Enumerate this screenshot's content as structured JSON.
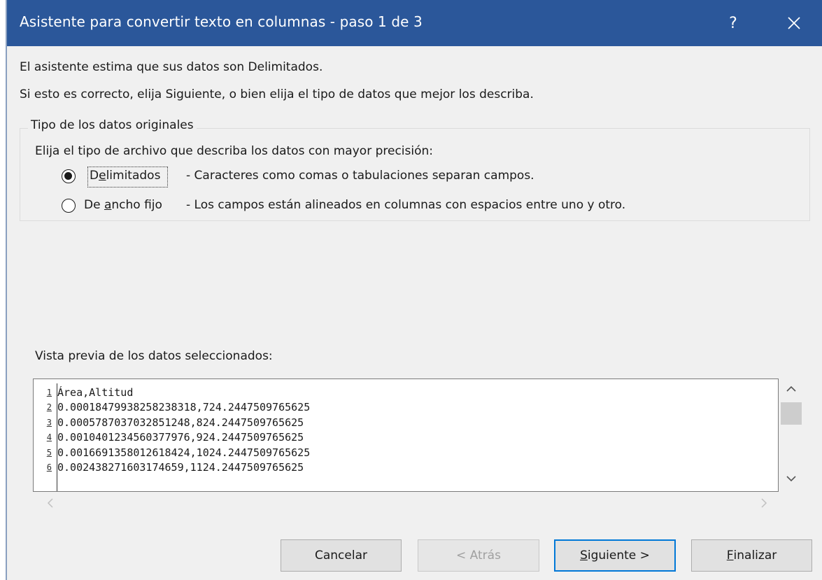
{
  "window": {
    "title": "Asistente para convertir texto en columnas - paso 1 de 3",
    "help_label": "?",
    "close_icon": "close-icon",
    "titlebar_color": "#2b579a"
  },
  "intro": {
    "line1": "El asistente estima que sus datos son Delimitados.",
    "line2": "Si esto es correcto, elija Siguiente, o bien elija el tipo de datos que mejor los describa."
  },
  "group": {
    "legend": "Tipo de los datos originales",
    "prompt": "Elija el tipo de archivo que describa los datos con mayor precisión:",
    "options": [
      {
        "label_pre": "D",
        "label_accel": "e",
        "label_post": "limitados",
        "description": "- Caracteres como comas o tabulaciones separan campos.",
        "selected": true
      },
      {
        "label_pre": "De ",
        "label_accel": "a",
        "label_post": "ncho fijo",
        "description": "- Los campos están alineados en columnas con espacios entre uno y otro.",
        "selected": false
      }
    ]
  },
  "preview": {
    "label": "Vista previa de los datos seleccionados:",
    "rows": [
      {
        "num": "1",
        "text": "Área,Altitud"
      },
      {
        "num": "2",
        "text": "0.00018479938258238318,724.2447509765625"
      },
      {
        "num": "3",
        "text": "0.0005787037032851248,824.2447509765625"
      },
      {
        "num": "4",
        "text": "0.0010401234560377976,924.2447509765625"
      },
      {
        "num": "5",
        "text": "0.0016691358012618424,1024.2447509765625"
      },
      {
        "num": "6",
        "text": "0.002438271603174659,1124.2447509765625"
      }
    ]
  },
  "buttons": {
    "cancel": "Cancelar",
    "back": "< Atrás",
    "next_accel": "S",
    "next_rest": "iguiente >",
    "finish_accel": "F",
    "finish_rest": "inalizar"
  }
}
